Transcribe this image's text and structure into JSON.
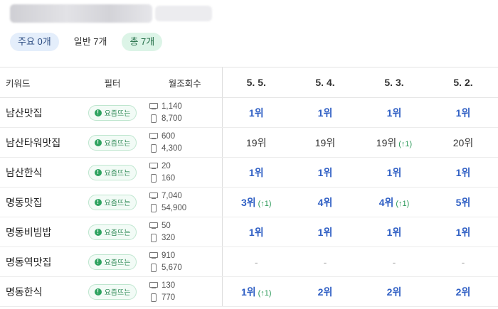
{
  "chips": [
    {
      "label": "주요 0개",
      "kind": "major"
    },
    {
      "label": "일반 7개",
      "kind": "normal"
    },
    {
      "label": "총 7개",
      "kind": "total"
    }
  ],
  "table": {
    "headers": {
      "keyword": "키워드",
      "filter": "필터",
      "monthly": "월조회수"
    },
    "dates": [
      "5. 5.",
      "5. 4.",
      "5. 3.",
      "5. 2."
    ],
    "tag_label": "요즘뜨는",
    "rows": [
      {
        "keyword": "남산맛집",
        "pc": "1,140",
        "mobile": "8,700",
        "ranks": [
          {
            "text": "1위",
            "style": "blue"
          },
          {
            "text": "1위",
            "style": "blue"
          },
          {
            "text": "1위",
            "style": "blue"
          },
          {
            "text": "1위",
            "style": "blue"
          }
        ]
      },
      {
        "keyword": "남산타워맛집",
        "pc": "600",
        "mobile": "4,300",
        "ranks": [
          {
            "text": "19위",
            "style": "plain"
          },
          {
            "text": "19위",
            "style": "plain"
          },
          {
            "text": "19위",
            "style": "plain",
            "up": "(↑1)"
          },
          {
            "text": "20위",
            "style": "plain"
          }
        ]
      },
      {
        "keyword": "남산한식",
        "pc": "20",
        "mobile": "160",
        "ranks": [
          {
            "text": "1위",
            "style": "blue"
          },
          {
            "text": "1위",
            "style": "blue"
          },
          {
            "text": "1위",
            "style": "blue"
          },
          {
            "text": "1위",
            "style": "blue"
          }
        ]
      },
      {
        "keyword": "명동맛집",
        "pc": "7,040",
        "mobile": "54,900",
        "ranks": [
          {
            "text": "3위",
            "style": "blue",
            "up": "(↑1)"
          },
          {
            "text": "4위",
            "style": "blue"
          },
          {
            "text": "4위",
            "style": "blue",
            "up": "(↑1)"
          },
          {
            "text": "5위",
            "style": "blue"
          }
        ]
      },
      {
        "keyword": "명동비빔밥",
        "pc": "50",
        "mobile": "320",
        "ranks": [
          {
            "text": "1위",
            "style": "blue"
          },
          {
            "text": "1위",
            "style": "blue"
          },
          {
            "text": "1위",
            "style": "blue"
          },
          {
            "text": "1위",
            "style": "blue"
          }
        ]
      },
      {
        "keyword": "명동역맛집",
        "pc": "910",
        "mobile": "5,670",
        "ranks": [
          {
            "text": "-",
            "style": "dash"
          },
          {
            "text": "-",
            "style": "dash"
          },
          {
            "text": "-",
            "style": "dash"
          },
          {
            "text": "-",
            "style": "dash"
          }
        ]
      },
      {
        "keyword": "명동한식",
        "pc": "130",
        "mobile": "770",
        "ranks": [
          {
            "text": "1위",
            "style": "blue",
            "up": "(↑1)"
          },
          {
            "text": "2위",
            "style": "blue"
          },
          {
            "text": "2위",
            "style": "blue"
          },
          {
            "text": "2위",
            "style": "blue"
          }
        ]
      }
    ]
  },
  "icons": {
    "pc": "desktop-icon",
    "mobile": "mobile-icon",
    "tag": "exclamation-circle-icon"
  }
}
